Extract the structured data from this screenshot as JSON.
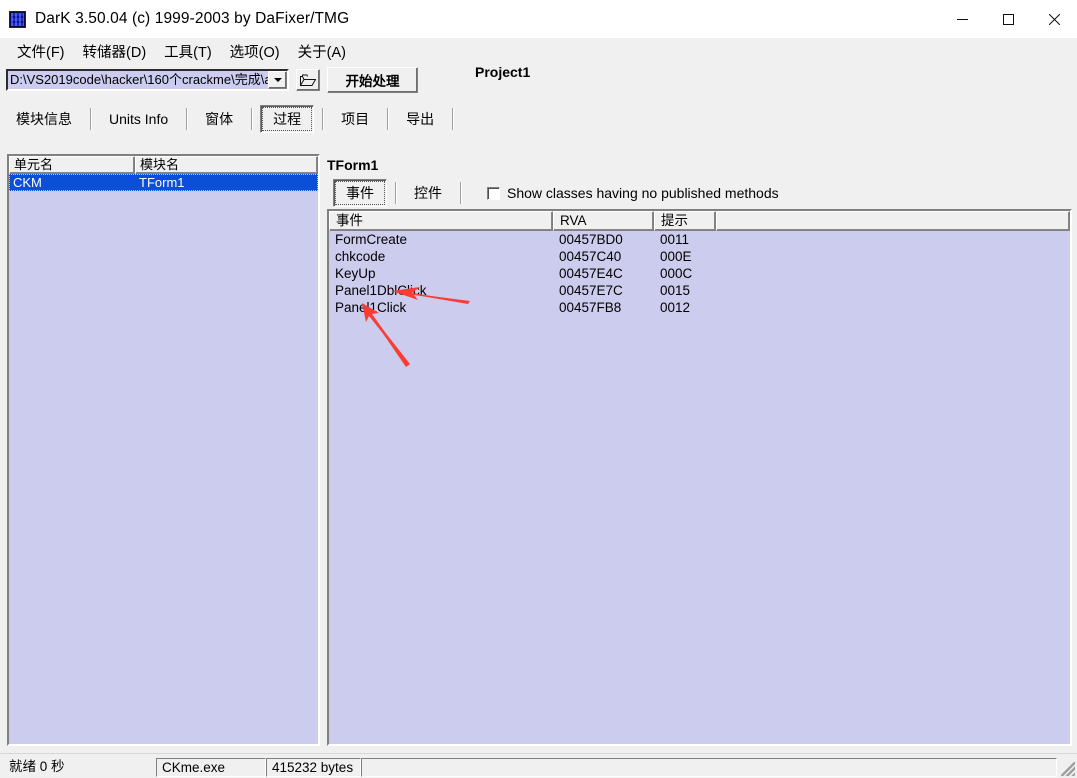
{
  "window": {
    "title": "DarK 3.50.04 (c) 1999-2003 by DaFixer/TMG",
    "icon": "app-icon",
    "controls": {
      "minimize": "minimize-icon",
      "maximize": "maximize-icon",
      "close": "close-icon"
    }
  },
  "menu": {
    "items": [
      {
        "label": "文件(F)"
      },
      {
        "label": "转储器(D)"
      },
      {
        "label": "工具(T)"
      },
      {
        "label": "选项(O)"
      },
      {
        "label": "关于(A)"
      }
    ]
  },
  "toolbar": {
    "path_value": "D:\\VS2019code\\hacker\\160个crackme\\完成\\a",
    "dropdown_icon": "chevron-down-icon",
    "browse_icon": "folder-open-icon",
    "start_button": "开始处理",
    "project_label": "Project1"
  },
  "tabs": {
    "items": [
      {
        "label": "模块信息",
        "selected": false
      },
      {
        "label": "Units Info",
        "selected": false
      },
      {
        "label": "窗体",
        "selected": false
      },
      {
        "label": "过程",
        "selected": true
      },
      {
        "label": "项目",
        "selected": false
      },
      {
        "label": "导出",
        "selected": false
      }
    ]
  },
  "left_panel": {
    "columns": [
      "单元名",
      "模块名"
    ],
    "rows": [
      {
        "unit": "CKM",
        "module": "TForm1",
        "selected": true
      }
    ],
    "selection_color": "#0b4ed8",
    "body_color": "#ccccee"
  },
  "right_panel": {
    "title": "TForm1",
    "tabs": [
      {
        "label": "事件",
        "selected": true
      },
      {
        "label": "控件",
        "selected": false
      }
    ],
    "checkbox": {
      "label": "Show classes having no published methods",
      "checked": false
    },
    "grid": {
      "columns": [
        "事件",
        "RVA",
        "提示",
        ""
      ],
      "rows": [
        {
          "event": "FormCreate",
          "rva": "00457BD0",
          "hint": "0011",
          "extra": ""
        },
        {
          "event": "chkcode",
          "rva": "00457C40",
          "hint": "000E",
          "extra": ""
        },
        {
          "event": "KeyUp",
          "rva": "00457E4C",
          "hint": "000C",
          "extra": ""
        },
        {
          "event": "Panel1DblClick",
          "rva": "00457E7C",
          "hint": "0015",
          "extra": ""
        },
        {
          "event": "Panel1Click",
          "rva": "00457FB8",
          "hint": "0012",
          "extra": ""
        }
      ]
    }
  },
  "statusbar": {
    "status": "就绪 0 秒",
    "file_name": "CKme.exe",
    "file_size": "415232 bytes",
    "extra": ""
  },
  "annotations": {
    "arrow_color": "#fa3c32",
    "arrows": [
      {
        "name": "arrow-panel1dblclick",
        "points_to": "Panel1DblClick"
      },
      {
        "name": "arrow-panel1click",
        "points_to": "Panel1Click"
      }
    ]
  }
}
